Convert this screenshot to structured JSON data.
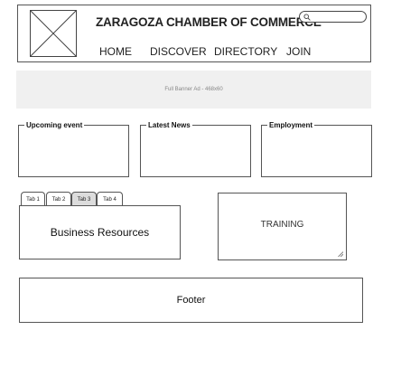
{
  "header": {
    "title": "ZARAGOZA CHAMBER OF COMMERCE",
    "search": {
      "placeholder": "",
      "value": ""
    },
    "nav": [
      {
        "label": "HOME"
      },
      {
        "label": "DISCOVER"
      },
      {
        "label": "DIRECTORY"
      },
      {
        "label": "JOIN"
      }
    ]
  },
  "banner": {
    "label": "Full Banner Ad - 468x60"
  },
  "sections": [
    {
      "legend": "Upcoming event"
    },
    {
      "legend": "Latest News"
    },
    {
      "legend": "Employment"
    }
  ],
  "tabs": {
    "items": [
      {
        "label": "Tab 1"
      },
      {
        "label": "Tab 2"
      },
      {
        "label": "Tab 3"
      },
      {
        "label": "Tab 4"
      }
    ],
    "active_index": 2,
    "panel_content": "Business Resources"
  },
  "training": {
    "text": "TRAINING"
  },
  "footer": {
    "text": "Footer"
  },
  "colors": {
    "border": "#555555",
    "banner_bg": "#f0f0f0",
    "active_tab_bg": "#dcdcdc"
  }
}
